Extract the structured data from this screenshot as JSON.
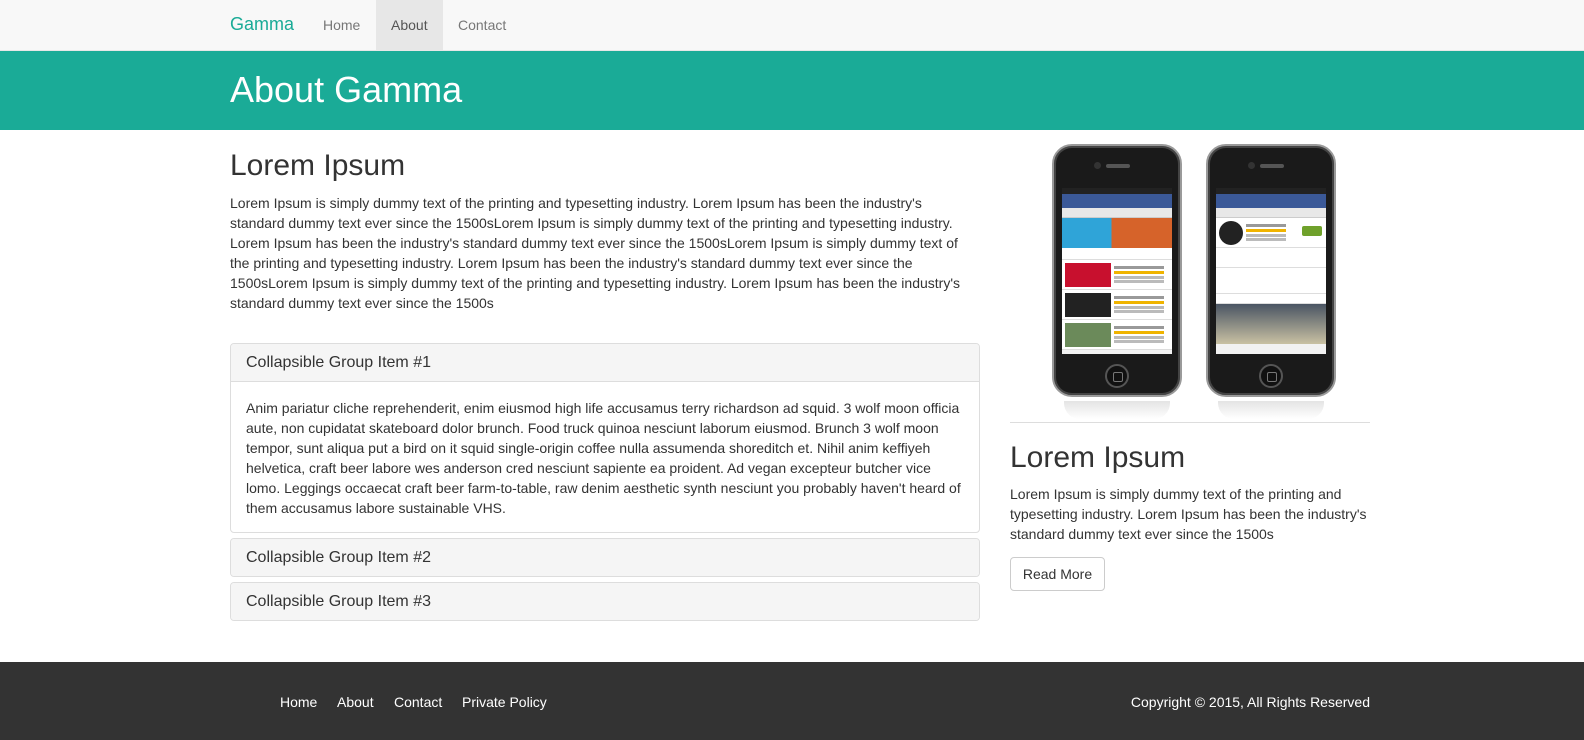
{
  "navbar": {
    "brand": "Gamma",
    "items": [
      {
        "label": "Home",
        "active": false
      },
      {
        "label": "About",
        "active": true
      },
      {
        "label": "Contact",
        "active": false
      }
    ]
  },
  "banner": {
    "title": "About Gamma"
  },
  "main": {
    "heading": "Lorem Ipsum",
    "text": "Lorem Ipsum is simply dummy text of the printing and typesetting industry. Lorem Ipsum has been the industry's standard dummy text ever since the 1500sLorem Ipsum is simply dummy text of the printing and typesetting industry. Lorem Ipsum has been the industry's standard dummy text ever since the 1500sLorem Ipsum is simply dummy text of the printing and typesetting industry. Lorem Ipsum has been the industry's standard dummy text ever since the 1500sLorem Ipsum is simply dummy text of the printing and typesetting industry. Lorem Ipsum has been the industry's standard dummy text ever since the 1500s",
    "accordion": [
      {
        "title": "Collapsible Group Item #1",
        "expanded": true,
        "body": "Anim pariatur cliche reprehenderit, enim eiusmod high life accusamus terry richardson ad squid. 3 wolf moon officia aute, non cupidatat skateboard dolor brunch. Food truck quinoa nesciunt laborum eiusmod. Brunch 3 wolf moon tempor, sunt aliqua put a bird on it squid single-origin coffee nulla assumenda shoreditch et. Nihil anim keffiyeh helvetica, craft beer labore wes anderson cred nesciunt sapiente ea proident. Ad vegan excepteur butcher vice lomo. Leggings occaecat craft beer farm-to-table, raw denim aesthetic synth nesciunt you probably haven't heard of them accusamus labore sustainable VHS."
      },
      {
        "title": "Collapsible Group Item #2",
        "expanded": false
      },
      {
        "title": "Collapsible Group Item #3",
        "expanded": false
      }
    ]
  },
  "sidebar": {
    "image": {
      "description_icon": "phone-screenshots-image"
    },
    "heading": "Lorem Ipsum",
    "text": "Lorem Ipsum is simply dummy text of the printing and typesetting industry. Lorem Ipsum has been the industry's standard dummy text ever since the 1500s",
    "button_label": "Read More"
  },
  "footer": {
    "links": [
      "Home",
      "About",
      "Contact",
      "Private Policy"
    ],
    "copyright": "Copyright © 2015, All Rights Reserved"
  },
  "colors": {
    "accent": "#1aab97",
    "navbar_bg": "#f8f8f8",
    "footer_bg": "#333333"
  }
}
